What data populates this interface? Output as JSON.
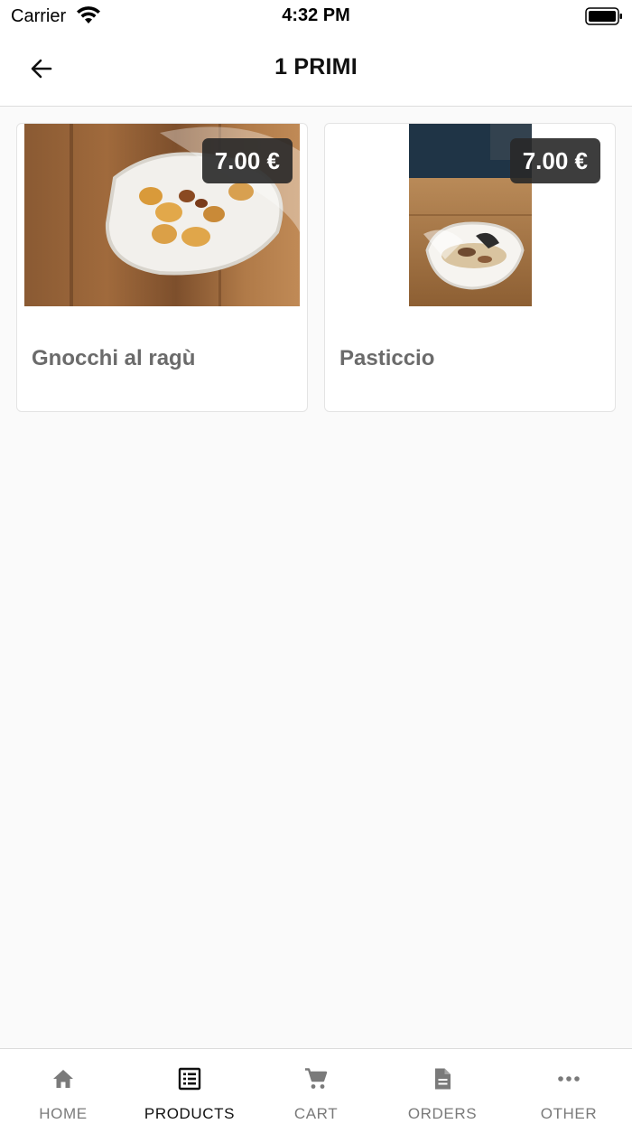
{
  "status_bar": {
    "carrier": "Carrier",
    "time": "4:32 PM"
  },
  "header": {
    "title": "1 PRIMI",
    "back_icon": "arrow-left-icon"
  },
  "products": [
    {
      "name": "Gnocchi al ragù",
      "price": "7.00 €"
    },
    {
      "name": "Pasticcio",
      "price": "7.00 €"
    }
  ],
  "tabbar": {
    "active": "PRODUCTS",
    "tabs": [
      {
        "label": "HOME",
        "icon": "home-icon"
      },
      {
        "label": "PRODUCTS",
        "icon": "list-icon"
      },
      {
        "label": "CART",
        "icon": "cart-icon"
      },
      {
        "label": "ORDERS",
        "icon": "document-icon"
      },
      {
        "label": "OTHER",
        "icon": "more-icon"
      }
    ]
  },
  "colors": {
    "background": "#fafafa",
    "price_badge": "#282828",
    "tab_inactive": "#7a7a7a",
    "tab_active": "#111111"
  }
}
